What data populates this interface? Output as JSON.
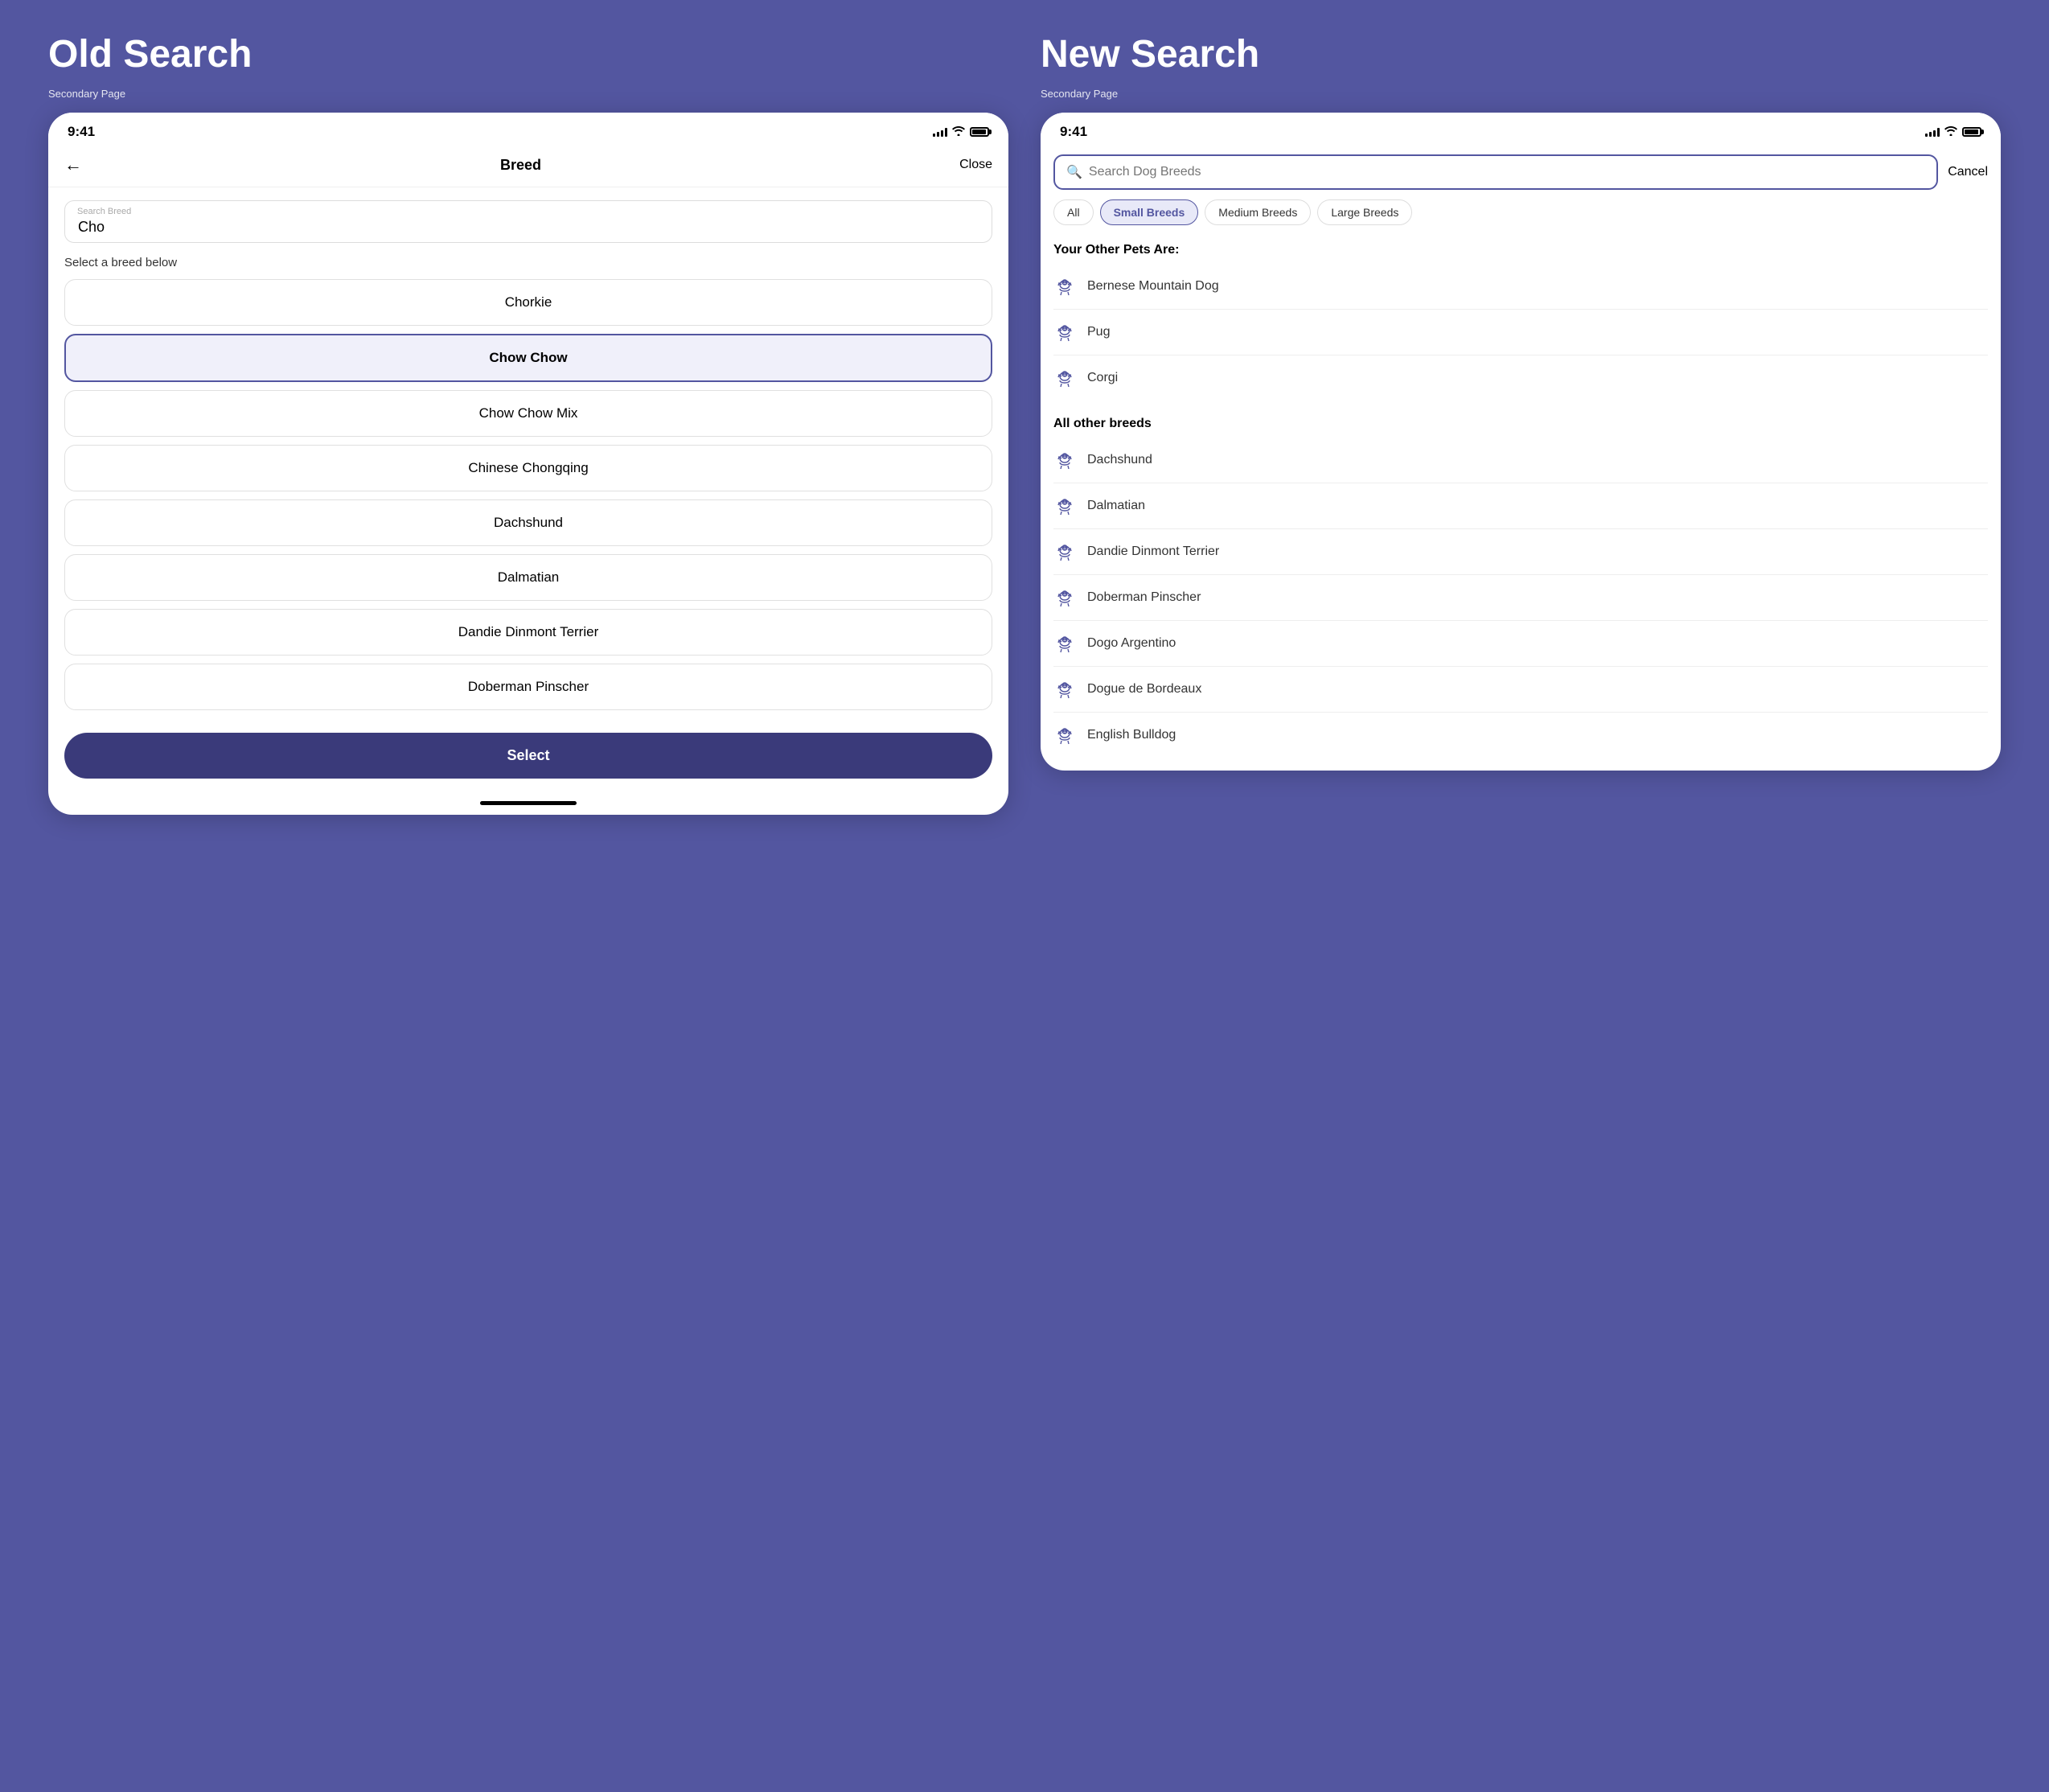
{
  "oldSearch": {
    "title": "Old Search",
    "secondaryLabel": "Secondary Page",
    "statusTime": "9:41",
    "navBack": "←",
    "navTitle": "Breed",
    "navClose": "Close",
    "searchLabel": "Search Breed",
    "searchValue": "Cho",
    "selectBreedLabel": "Select a breed below",
    "breeds": [
      {
        "name": "Chorkie",
        "selected": false
      },
      {
        "name": "Chow Chow",
        "selected": true
      },
      {
        "name": "Chow Chow Mix",
        "selected": false
      },
      {
        "name": "Chinese Chongqing",
        "selected": false
      },
      {
        "name": "Dachshund",
        "selected": false
      },
      {
        "name": "Dalmatian",
        "selected": false
      },
      {
        "name": "Dandie Dinmont Terrier",
        "selected": false
      },
      {
        "name": "Doberman Pinscher",
        "selected": false
      }
    ],
    "selectBtn": "Select"
  },
  "newSearch": {
    "title": "New Search",
    "secondaryLabel": "Secondary Page",
    "statusTime": "9:41",
    "searchPlaceholder": "Search Dog Breeds",
    "cancelBtn": "Cancel",
    "chips": [
      {
        "label": "All",
        "active": false
      },
      {
        "label": "Small Breeds",
        "active": true
      },
      {
        "label": "Medium Breeds",
        "active": false
      },
      {
        "label": "Large Breeds",
        "active": false
      }
    ],
    "yourPetsTitle": "Your Other Pets Are:",
    "yourPets": [
      {
        "name": "Bernese Mountain Dog"
      },
      {
        "name": "Pug"
      },
      {
        "name": "Corgi"
      }
    ],
    "allBreedsTitle": "All other breeds",
    "allBreeds": [
      {
        "name": "Dachshund"
      },
      {
        "name": "Dalmatian"
      },
      {
        "name": "Dandie Dinmont Terrier"
      },
      {
        "name": "Doberman Pinscher"
      },
      {
        "name": "Dogo Argentino"
      },
      {
        "name": "Dogue de Bordeaux"
      },
      {
        "name": "English Bulldog"
      }
    ]
  }
}
